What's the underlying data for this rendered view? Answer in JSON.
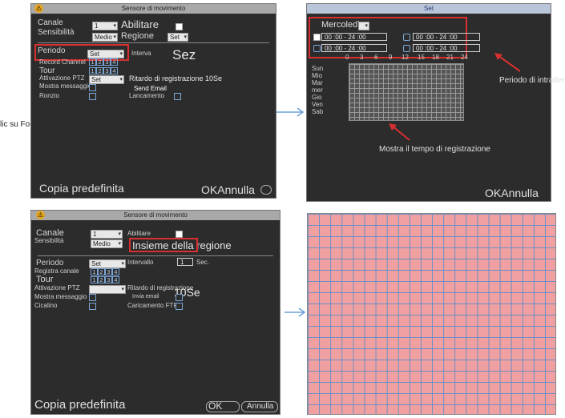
{
  "left_cut_text": "lic su Formatta. IL",
  "panel1": {
    "title": "Sensore di movimento",
    "channel_label": "Canale",
    "channel_value": "1",
    "enable_label": "Abilitare",
    "sensitivity_label": "Sensibilità",
    "sensitivity_value": "Medio",
    "region_label": "Regione",
    "region_btn": "Set",
    "period_label": "Periodo",
    "period_btn": "Set",
    "interval_label": "Interva",
    "sec_overlay": "Sez",
    "record_channel_label": "Record Channel",
    "channels": [
      "1",
      "2",
      "3",
      "4"
    ],
    "tour_label": "Tour",
    "ptz_label": "Attivazione PTZ",
    "ptz_btn": "Set",
    "delay_label": "Ritardo di registrazione 10Se",
    "show_message_label": "Mostra messaggio",
    "send_email_label": "Send Email",
    "buzzer_label": "Ronzio",
    "upload_label": "Lancamento",
    "default_btn": "Copia predefinita",
    "ok_cancel": "OKAnnulla"
  },
  "panel2": {
    "title": "Set",
    "day_select": "Mercoledì",
    "time_slots": [
      "00 :00   -   24 :00",
      "00 :00   -   24 :00",
      "00 :00   -   24 :00",
      "00 :00   -   24 :00"
    ],
    "hour_ticks": [
      "0",
      "3",
      "6",
      "9",
      "12",
      "15",
      "18",
      "21",
      "24"
    ],
    "days": [
      "Sun",
      "Mio",
      "Mar",
      "mer",
      "Gio",
      "Ven",
      "Sab"
    ],
    "annotation_period": "Periodo di intrattenme",
    "annotation_show": "Mostra il tempo di registrazione",
    "ok_cancel": "OKAnnulla"
  },
  "panel3": {
    "title": "Sensore di movimento",
    "channel_label": "Canale",
    "channel_value": "1",
    "enable_label": "Abilitare",
    "sensitivity_label": "Sensibilità",
    "sensitivity_value": "Medio",
    "region_overlay": "Insieme della regione",
    "period_label": "Periodo",
    "period_btn": "Set",
    "interval_label": "Intervallo",
    "interval_value": "1",
    "sec_label": "Sec.",
    "record_channel_label": "Registra canale",
    "channels": [
      "1",
      "2",
      "3",
      "4"
    ],
    "tour_label": "Tour",
    "ptz_label": "Attivazione PTZ",
    "delay_label": "Ritardo di registrazione",
    "delay_value": "10Se",
    "show_message_label": "Mostra messaggio",
    "send_email_label": "Invia email",
    "buzzer_label": "Cicalino",
    "upload_label": "Caricamento FTP",
    "default_btn": "Copia predefinita",
    "ok_btn": "OK",
    "cancel_btn": "Annulla"
  },
  "colors": {
    "panel_bg": "#2c2c2c",
    "highlight_red": "#d83030",
    "grid_pink": "#f0a0a0",
    "grid_line": "#6b8fc7",
    "arrow_blue": "#6a9fd8"
  }
}
